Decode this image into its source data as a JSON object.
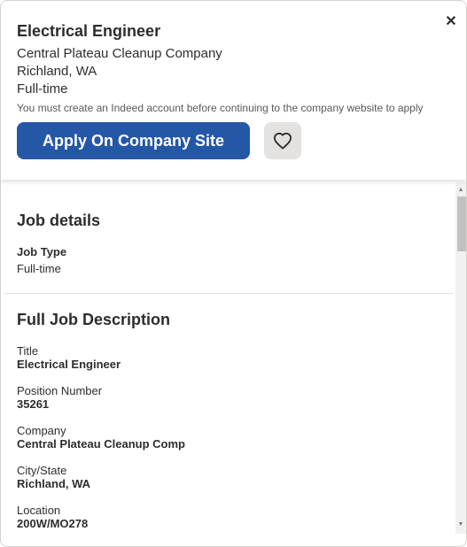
{
  "header": {
    "title": "Electrical Engineer",
    "company": "Central Plateau Cleanup Company",
    "location": "Richland, WA",
    "job_type": "Full-time",
    "notice": "You must create an Indeed account before continuing to the company website to apply",
    "apply_label": "Apply On Company Site",
    "close_label": "✕"
  },
  "job_details": {
    "heading": "Job details",
    "type_label": "Job Type",
    "type_value": "Full-time"
  },
  "description": {
    "heading": "Full Job Description",
    "fields": [
      {
        "label": "Title",
        "value": "Electrical Engineer"
      },
      {
        "label": "Position Number",
        "value": "35261"
      },
      {
        "label": "Company",
        "value": "Central Plateau Cleanup Comp"
      },
      {
        "label": "City/State",
        "value": "Richland, WA"
      },
      {
        "label": "Location",
        "value": "200W/MO278"
      }
    ]
  },
  "scrollbar": {
    "up_arrow": "▲",
    "down_arrow": "▼"
  },
  "colors": {
    "accent": "#2557a7",
    "save_bg": "#e4e2e0",
    "text": "#2d2d2d"
  }
}
